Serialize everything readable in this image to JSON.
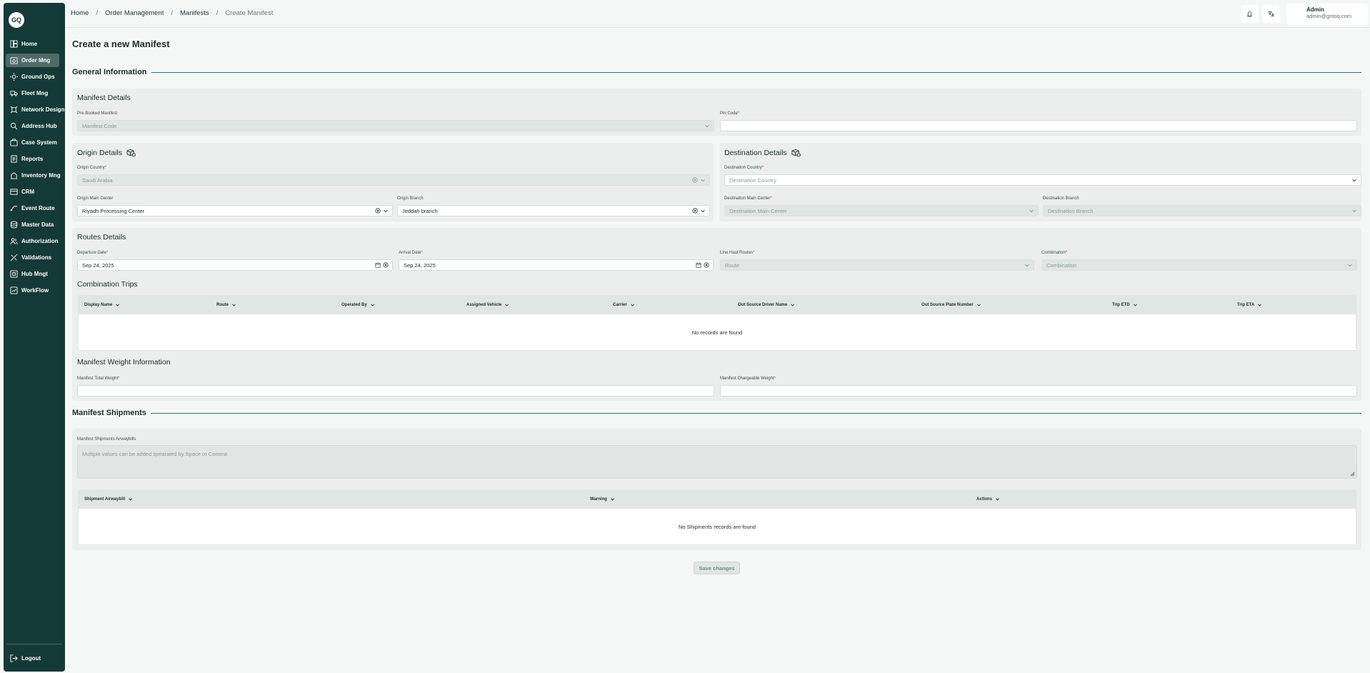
{
  "sidebar": {
    "logo": "GQ",
    "items": [
      {
        "label": "Home",
        "icon": "home-icon"
      },
      {
        "label": "Order Mng",
        "icon": "order-icon",
        "active": true
      },
      {
        "label": "Ground Ops",
        "icon": "ground-ops-icon"
      },
      {
        "label": "Fleet Mng",
        "icon": "truck-icon"
      },
      {
        "label": "Network Design",
        "icon": "network-icon"
      },
      {
        "label": "Address Hub",
        "icon": "address-icon"
      },
      {
        "label": "Case System",
        "icon": "case-icon"
      },
      {
        "label": "Reports",
        "icon": "reports-icon"
      },
      {
        "label": "Inventory Mng",
        "icon": "inventory-icon"
      },
      {
        "label": "CRM",
        "icon": "crm-icon"
      },
      {
        "label": "Event Route",
        "icon": "event-route-icon"
      },
      {
        "label": "Master Data",
        "icon": "database-icon"
      },
      {
        "label": "Authorization",
        "icon": "users-icon"
      },
      {
        "label": "Validations",
        "icon": "validations-icon"
      },
      {
        "label": "Hub Mngt",
        "icon": "hub-icon"
      },
      {
        "label": "WorkFlow",
        "icon": "workflow-icon"
      }
    ],
    "logout": "Logout"
  },
  "breadcrumb": {
    "items": [
      "Home",
      "Order Management",
      "Manifests"
    ],
    "current": "Create Manifest"
  },
  "user": {
    "name": "Admin",
    "email": "admin@gntoq.com"
  },
  "page_title": "Create a new Manifest",
  "general_information": {
    "title": "General Information",
    "manifest_details": {
      "title": "Manifest Details",
      "pre_booked_label": "Pre-Booked Manifest",
      "pre_booked_placeholder": "Manifest Code",
      "pin_code_label": "Pin Code"
    },
    "origin": {
      "title": "Origin Details",
      "country_label": "Origin Country",
      "country_value": "Saudi Arabia",
      "main_center_label": "Origin Main Center",
      "main_center_value": "Riyadh Processing Center",
      "branch_label": "Origin Branch",
      "branch_value": "Jeddah branch"
    },
    "destination": {
      "title": "Destination Details",
      "country_label": "Destination Country",
      "country_placeholder": "Destination Country",
      "main_center_label": "Destination Main Center",
      "main_center_placeholder": "Destination Main Center",
      "branch_label": "Destination Branch",
      "branch_placeholder": "Destination Branch"
    },
    "routes": {
      "title": "Routes Details",
      "departure_label": "Departure Date",
      "departure_value": "Sep 24, 2025",
      "arrival_label": "Arrival Date",
      "arrival_value": "Sep 24, 2025",
      "line_haul_label": "Line Haul Routes",
      "line_haul_placeholder": "Route",
      "combination_label": "Combination",
      "combination_placeholder": "Combination"
    },
    "combination_trips": {
      "title": "Combination Trips",
      "columns": [
        "Display Name",
        "Route",
        "Operated By",
        "Assigned Vehicle",
        "Carrier",
        "Out Source Driver Name",
        "Out Source Plate Number",
        "Trip ETD",
        "Trip ETA"
      ],
      "empty": "No records are found"
    },
    "weight": {
      "title": "Manifest Weight Information",
      "total_label": "Manifest Total Weight",
      "chargeable_label": "Manifest Chargeable Weight"
    }
  },
  "shipments": {
    "title": "Manifest Shipments",
    "airwaybills_label": "Manifest Shipments Airwaybills",
    "airwaybills_placeholder": "Multiple values can be added spearated by Space or Comma",
    "columns": [
      "Shipment Airwaybill",
      "Warning",
      "Actions"
    ],
    "empty": "No Shipments records are found"
  },
  "save_label": "Save changes"
}
